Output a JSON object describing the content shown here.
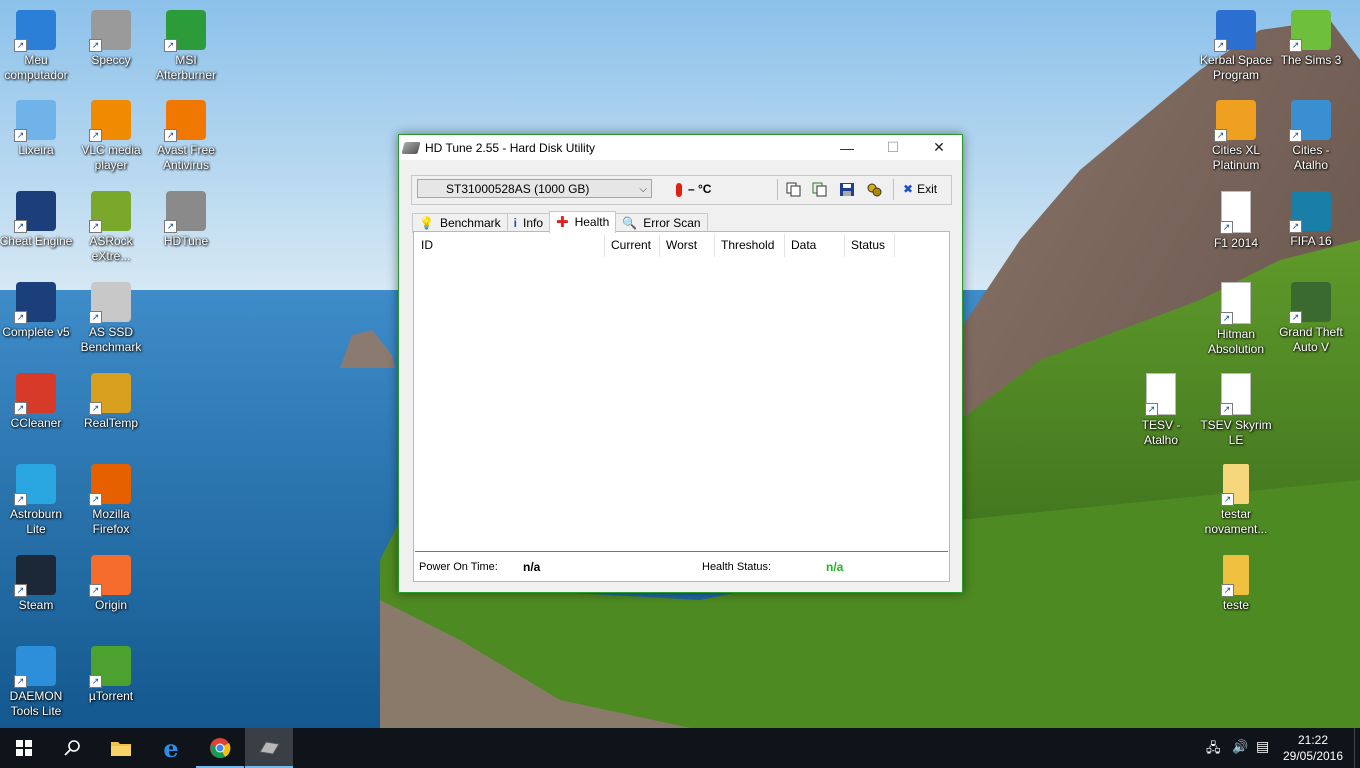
{
  "desktop": {
    "icons_left": [
      {
        "label": "Meu\ncomputador",
        "icon": "computer-icon",
        "color": "#2b7fd6"
      },
      {
        "label": "Speccy",
        "icon": "speccy-icon",
        "color": "#9a9a9a"
      },
      {
        "label": "MSI\nAfterburner",
        "icon": "msi-afterburner-icon",
        "color": "#2c9b3a"
      },
      {
        "label": "Lixeira",
        "icon": "recycle-bin-icon",
        "color": "#6fb3e8"
      },
      {
        "label": "VLC media\nplayer",
        "icon": "vlc-icon",
        "color": "#f08a00"
      },
      {
        "label": "Avast Free\nAntivirus",
        "icon": "avast-icon",
        "color": "#f07800"
      },
      {
        "label": "Cheat Engine",
        "icon": "cheat-engine-icon",
        "color": "#1a3f7a"
      },
      {
        "label": "ASRock\neXtre...",
        "icon": "asrock-icon",
        "color": "#7aa82a"
      },
      {
        "label": "HDTune",
        "icon": "hdtune-icon",
        "color": "#8a8a8a"
      },
      {
        "label": "Complete v5",
        "icon": "complete-icon",
        "color": "#1a3f7a"
      },
      {
        "label": "AS SSD\nBenchmark",
        "icon": "as-ssd-icon",
        "color": "#c8c8c8"
      },
      {
        "label": "CCleaner",
        "icon": "ccleaner-icon",
        "color": "#d83a2a"
      },
      {
        "label": "RealTemp",
        "icon": "realtemp-icon",
        "color": "#d9a020"
      },
      {
        "label": "Astroburn\nLite",
        "icon": "astroburn-icon",
        "color": "#2aa7e0"
      },
      {
        "label": "Mozilla\nFirefox",
        "icon": "firefox-icon",
        "color": "#e66000"
      },
      {
        "label": "Steam",
        "icon": "steam-icon",
        "color": "#1b2838"
      },
      {
        "label": "Origin",
        "icon": "origin-icon",
        "color": "#f56c2d"
      },
      {
        "label": "DAEMON\nTools Lite",
        "icon": "daemon-tools-icon",
        "color": "#2d8fd9"
      },
      {
        "label": "µTorrent",
        "icon": "utorrent-icon",
        "color": "#4da12e"
      }
    ],
    "icons_right": [
      {
        "label": "Kerbal Space\nProgram",
        "icon": "kerbal-icon",
        "color": "#2b6fd0"
      },
      {
        "label": "The Sims 3",
        "icon": "sims3-icon",
        "color": "#6ec03c"
      },
      {
        "label": "Cities XL\nPlatinum",
        "icon": "cities-xl-icon",
        "color": "#f0a020"
      },
      {
        "label": "Cities -\nAtalho",
        "icon": "cities-icon",
        "color": "#3a8fd0"
      },
      {
        "label": "F1 2014",
        "icon": "file-icon",
        "color": "#ffffff"
      },
      {
        "label": "FIFA 16",
        "icon": "fifa16-icon",
        "color": "#1a7fa8"
      },
      {
        "label": "Hitman\nAbsolution",
        "icon": "file-icon",
        "color": "#ffffff"
      },
      {
        "label": "Grand Theft\nAuto V",
        "icon": "gta-v-icon",
        "color": "#3a6a30"
      },
      {
        "label": "TESV -\nAtalho",
        "icon": "file-icon",
        "color": "#ffffff"
      },
      {
        "label": "TSEV Skyrim\nLE",
        "icon": "file-icon",
        "color": "#ffffff"
      },
      {
        "label": "testar\nnovament...",
        "icon": "folder-icon",
        "color": "#f5d67a"
      },
      {
        "label": "teste",
        "icon": "folder-icon",
        "color": "#f0c040"
      }
    ]
  },
  "window": {
    "title": "HD Tune 2.55 - Hard Disk Utility",
    "minimize": "—",
    "maximize": "☐",
    "close": "✕",
    "drive": "ST31000528AS (1000 GB)",
    "temperature": "– °C",
    "exit_label": "Exit",
    "tabs": [
      {
        "label": "Benchmark",
        "icon": "benchmark-icon"
      },
      {
        "label": "Info",
        "icon": "info-icon"
      },
      {
        "label": "Health",
        "icon": "health-icon"
      },
      {
        "label": "Error Scan",
        "icon": "error-scan-icon"
      }
    ],
    "active_tab": "Health",
    "columns": [
      "ID",
      "Current",
      "Worst",
      "Threshold",
      "Data",
      "Status"
    ],
    "power_on_label": "Power On Time:",
    "power_on_value": "n/a",
    "health_label": "Health Status:",
    "health_value": "n/a",
    "health_value_color": "#22b422"
  },
  "taskbar": {
    "time": "21:22",
    "date": "29/05/2016"
  }
}
